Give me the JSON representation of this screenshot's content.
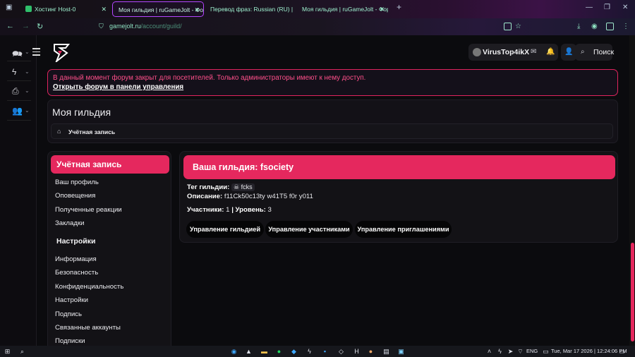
{
  "browser": {
    "tabs": [
      {
        "label": "Хостинг Host-0",
        "active": false
      },
      {
        "label": "Моя гильдия | ruGameJolt - Форум",
        "active": true
      },
      {
        "label": "Перевод фраз: Russian (RU) | ruGa",
        "active": false
      },
      {
        "label": "Моя гильдия | ruGameJolt - Форум",
        "active": false
      }
    ],
    "new_tab": "+",
    "url_host": "gamejolt.ru",
    "url_path": "/account/guild/"
  },
  "header": {
    "username": "VirusTop4ikX",
    "search_label": "Поиск"
  },
  "notice": {
    "text": "В данный момент форум закрыт для посетителей. Только администраторы имеют к нему доступ.",
    "link": "Открыть форум в панели управления"
  },
  "page": {
    "title": "Моя гильдия",
    "breadcrumb": "Учётная запись"
  },
  "sidebar": {
    "header": "Учётная запись",
    "items": [
      "Ваш профиль",
      "Оповещения",
      "Полученные реакции",
      "Закладки"
    ],
    "section2": "Настройки",
    "items2": [
      "Информация",
      "Безопасность",
      "Конфиденциальность",
      "Настройки",
      "Подпись",
      "Связанные аккаунты",
      "Подписки"
    ]
  },
  "guild": {
    "title": "Ваша гильдия: fsociety",
    "tag_label": "Тег гильдии:",
    "tag_value": "fcks",
    "desc_label": "Описание:",
    "desc_value": "f11Ck50c13ty w41T5 f0r y011",
    "members_label": "Участники:",
    "members_value": "1",
    "separator": "|",
    "level_label": "Уровень:",
    "level_value": "3",
    "buttons": [
      "Управление гильдией",
      "Управление участниками",
      "Управление приглашениями"
    ]
  },
  "taskbar": {
    "lang": "ENG",
    "datetime": "Tue, Mar 17 2026 | 12:24:06 PM"
  },
  "colors": {
    "accent": "#e5285e",
    "notice_text": "#ff4f8a",
    "background": "#0b0b0e"
  }
}
